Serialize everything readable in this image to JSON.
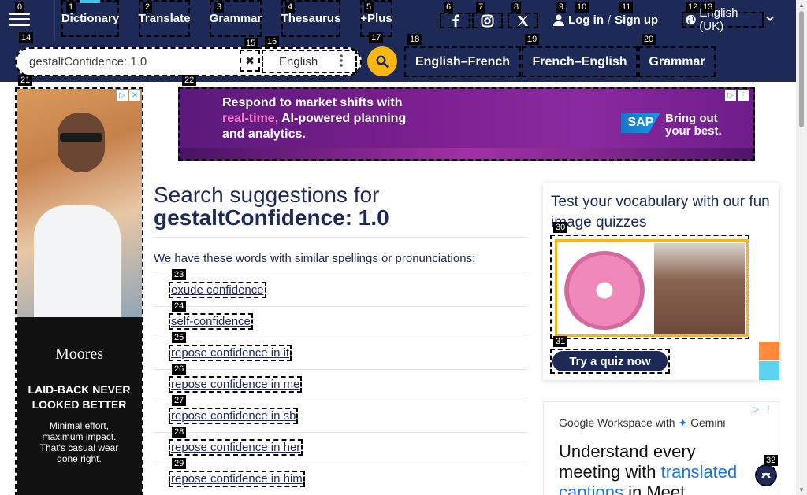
{
  "nav": {
    "links": [
      {
        "label": "Dictionary"
      },
      {
        "label": "Translate"
      },
      {
        "label": "Grammar"
      },
      {
        "label": "Thesaurus"
      },
      {
        "label": "+Plus"
      }
    ],
    "login_label": "Log in",
    "separator": "/",
    "signup_label": "Sign up",
    "language_label": "English (UK)"
  },
  "search": {
    "value": "gestaltConfidence: 1.0",
    "dictionary": "English",
    "links": [
      {
        "label": "English–French"
      },
      {
        "label": "French–English"
      },
      {
        "label": "Grammar"
      }
    ]
  },
  "ads": {
    "left": {
      "brand": "Moores",
      "tagline": "LAID-BACK NEVER LOOKED BETTER",
      "small": "Minimal effort, maximum impact. That's casual wear done right."
    },
    "top": {
      "line1": "Respond to market shifts with",
      "line2_highlight": "real-time,",
      "line2_rest": " AI-powered planning",
      "line3": "and analytics.",
      "logo": "SAP",
      "slogan1": "Bring out",
      "slogan2": "your best."
    },
    "bottom": {
      "brand": "Google Workspace with",
      "brand_name": "Gemini",
      "headline1": "Understand every",
      "headline2": "meeting with",
      "headline_blue": "translated",
      "headline3": "captions",
      "headline4": "in",
      "headline5": "Meet."
    }
  },
  "main": {
    "heading_prefix": "Search suggestions for",
    "heading_term": "gestaltConfidence: 1.0",
    "intro": "We have these words with similar spellings or pronunciations:",
    "suggestions": [
      "exude confidence",
      "self-confidence",
      "repose confidence in it",
      "repose confidence in me",
      "repose confidence in sb",
      "repose confidence in her",
      "repose confidence in him"
    ]
  },
  "quiz": {
    "title": "Test your vocabulary with our fun image quizzes",
    "button": "Try a quiz now"
  },
  "badges": [
    "0",
    "1",
    "2",
    "3",
    "4",
    "5",
    "6",
    "7",
    "8",
    "9",
    "10",
    "11",
    "12",
    "13",
    "14",
    "15",
    "16",
    "17",
    "18",
    "19",
    "20",
    "21",
    "22",
    "23",
    "24",
    "25",
    "26",
    "27",
    "28",
    "29",
    "30",
    "31",
    "32"
  ],
  "colors": {
    "nav_bg": "#1d2a57",
    "accent_yellow": "#f8b715",
    "active_underline": "#3fc1e8"
  }
}
